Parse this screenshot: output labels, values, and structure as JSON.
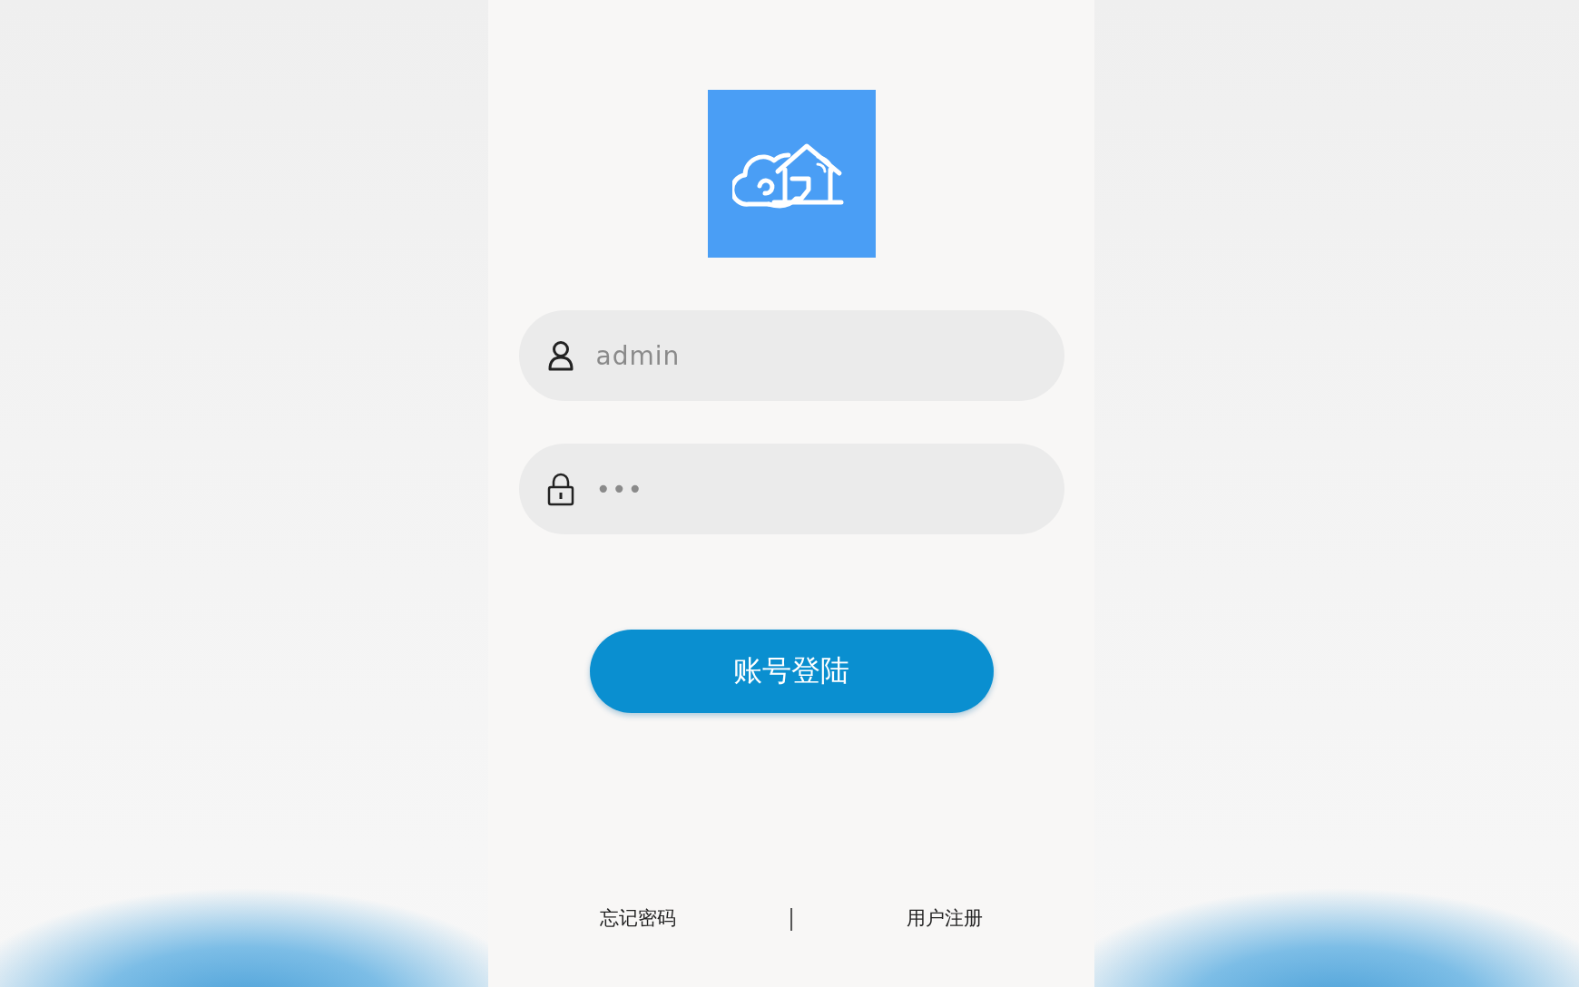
{
  "username": {
    "value": "admin"
  },
  "password": {
    "value": "•••"
  },
  "login_button": {
    "label": "账号登陆"
  },
  "links": [
    {
      "label": "忘记密码"
    },
    {
      "label": "用户注册"
    }
  ],
  "separator": "|"
}
